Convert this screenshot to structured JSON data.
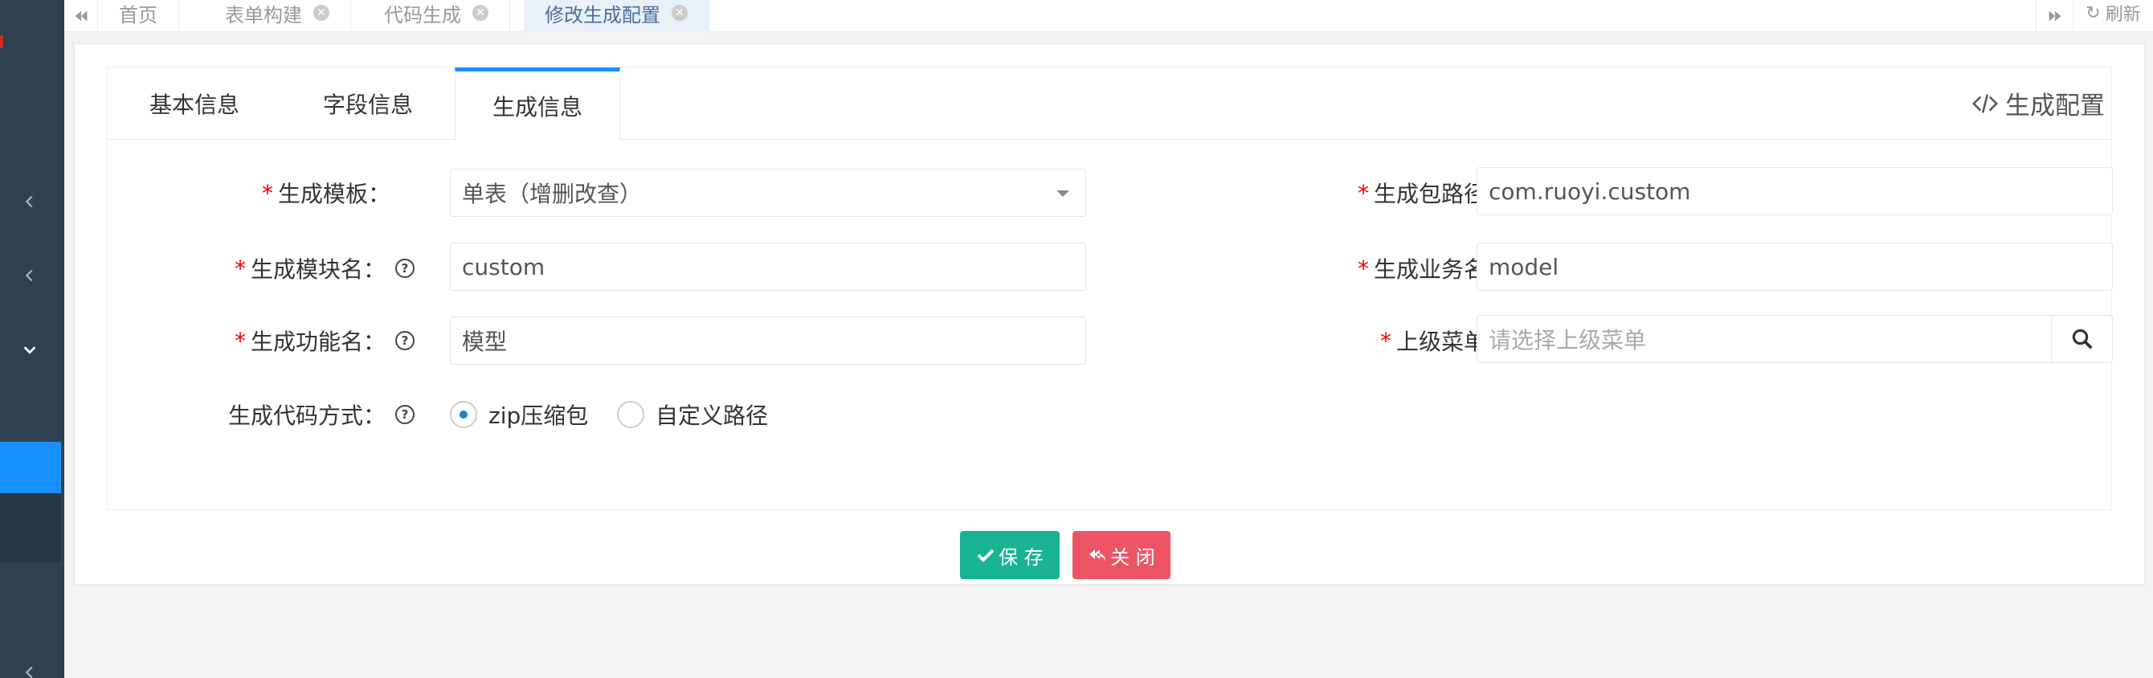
{
  "tabbar": {
    "tabs": [
      {
        "label": "首页"
      },
      {
        "label": "表单构建"
      },
      {
        "label": "代码生成"
      },
      {
        "label": "修改生成配置"
      }
    ],
    "refresh_label": "刷新"
  },
  "form_tabs": [
    {
      "label": "基本信息"
    },
    {
      "label": "字段信息"
    },
    {
      "label": "生成信息"
    }
  ],
  "gen_config_label": "生成配置",
  "fields": {
    "template": {
      "required": "*",
      "label": "生成模板：",
      "value": "单表（增删改查）"
    },
    "package_path": {
      "required": "*",
      "label": "生成包路径：",
      "value": "com.ruoyi.custom"
    },
    "module_name": {
      "required": "*",
      "label": "生成模块名：",
      "value": "custom"
    },
    "business_name": {
      "required": "*",
      "label": "生成业务名：",
      "value": "model"
    },
    "function_name": {
      "required": "*",
      "label": "生成功能名：",
      "value": "模型"
    },
    "parent_menu": {
      "required": "*",
      "label": "上级菜单：",
      "placeholder": "请选择上级菜单"
    },
    "gen_type": {
      "label": "生成代码方式：",
      "options": [
        "zip压缩包",
        "自定义路径"
      ],
      "selected": "zip压缩包"
    }
  },
  "buttons": {
    "save": "保 存",
    "close": "关 闭"
  },
  "colors": {
    "sidebar": "#2f4050",
    "accent": "#1890ff",
    "save": "#1ab394",
    "close": "#ed5565"
  }
}
